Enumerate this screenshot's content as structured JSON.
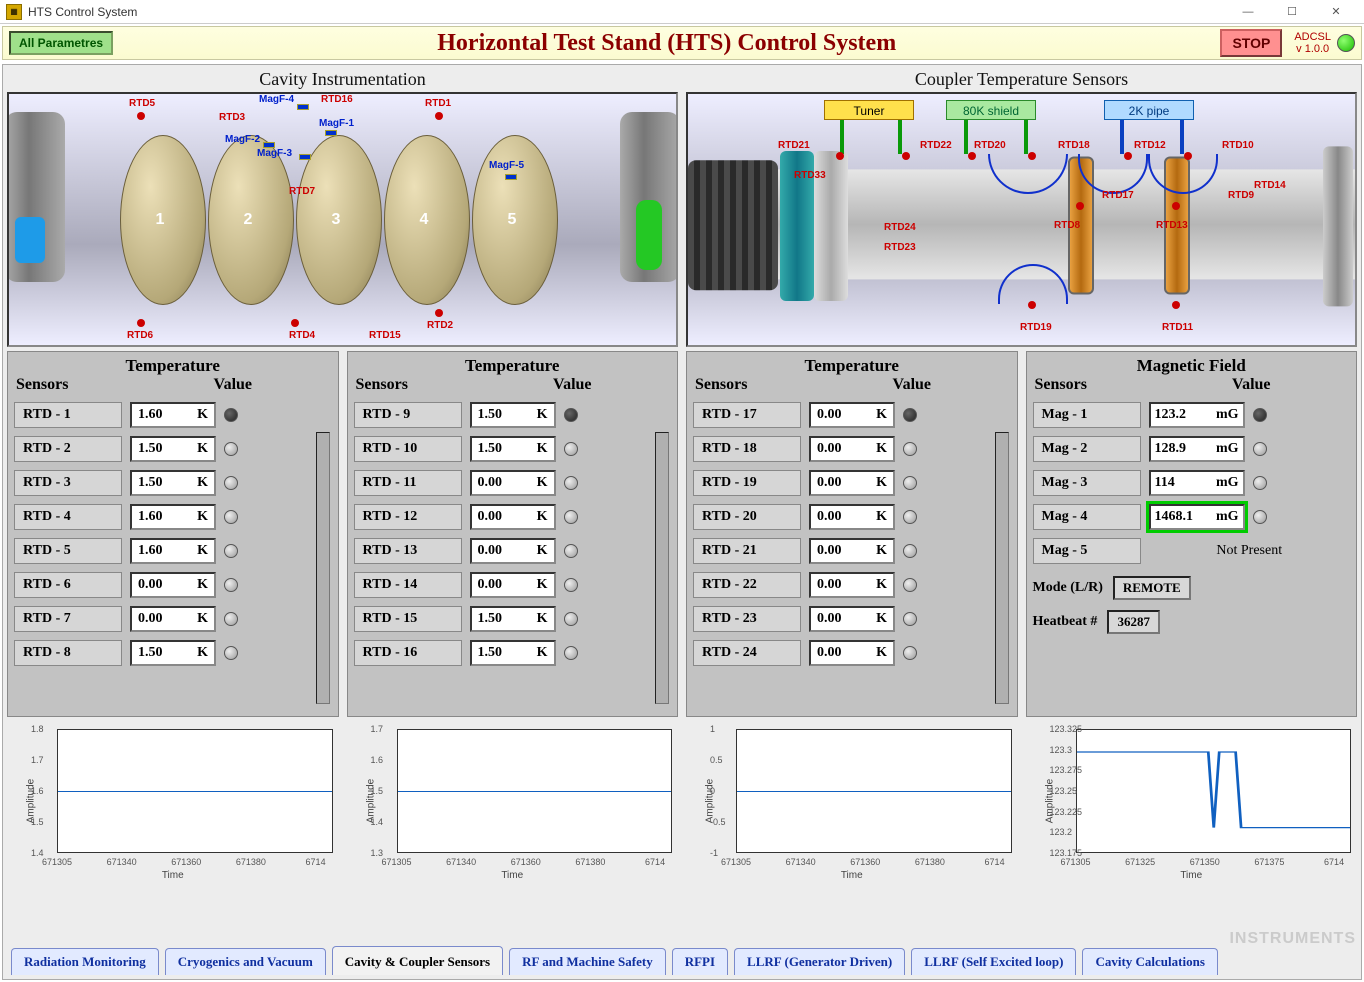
{
  "window": {
    "title": "HTS Control System"
  },
  "header": {
    "allparams": "All Parametres",
    "title": "Horizontal Test Stand (HTS) Control System",
    "stop": "STOP",
    "version_top": "ADCSL",
    "version_bottom": "v 1.0.0"
  },
  "diagrams": {
    "left_title": "Cavity Instrumentation",
    "right_title": "Coupler Temperature Sensors",
    "tuner": "Tuner",
    "shield": "80K  shield",
    "pipe": "2K pipe",
    "cavity_labels": [
      "RTD5",
      "RTD3",
      "MagF-4",
      "RTD16",
      "RTD1",
      "MagF-2",
      "MagF-1",
      "MagF-3",
      "RTD7",
      "MagF-5",
      "RTD6",
      "RTD4",
      "RTD15",
      "RTD2"
    ],
    "coupler_labels": [
      "RTD21",
      "RTD22",
      "RTD20",
      "RTD18",
      "RTD12",
      "RTD10",
      "RTD33",
      "RTD17",
      "RTD9",
      "RTD14",
      "RTD24",
      "RTD23",
      "RTD8",
      "RTD13",
      "RTD19",
      "RTD11"
    ]
  },
  "table_header": {
    "sensors": "Sensors",
    "value": "Value"
  },
  "panels": [
    {
      "title": "Temperature",
      "unit": "K",
      "rows": [
        {
          "name": "RTD - 1",
          "val": "1.60",
          "led": "dark"
        },
        {
          "name": "RTD - 2",
          "val": "1.50",
          "led": "off"
        },
        {
          "name": "RTD - 3",
          "val": "1.50",
          "led": "off"
        },
        {
          "name": "RTD - 4",
          "val": "1.60",
          "led": "off"
        },
        {
          "name": "RTD - 5",
          "val": "1.60",
          "led": "off"
        },
        {
          "name": "RTD - 6",
          "val": "0.00",
          "led": "off"
        },
        {
          "name": "RTD - 7",
          "val": "0.00",
          "led": "off"
        },
        {
          "name": "RTD - 8",
          "val": "1.50",
          "led": "off"
        }
      ]
    },
    {
      "title": "Temperature",
      "unit": "K",
      "rows": [
        {
          "name": "RTD - 9",
          "val": "1.50",
          "led": "dark"
        },
        {
          "name": "RTD - 10",
          "val": "1.50",
          "led": "off"
        },
        {
          "name": "RTD - 11",
          "val": "0.00",
          "led": "off"
        },
        {
          "name": "RTD - 12",
          "val": "0.00",
          "led": "off"
        },
        {
          "name": "RTD - 13",
          "val": "0.00",
          "led": "off"
        },
        {
          "name": "RTD - 14",
          "val": "0.00",
          "led": "off"
        },
        {
          "name": "RTD - 15",
          "val": "1.50",
          "led": "off"
        },
        {
          "name": "RTD - 16",
          "val": "1.50",
          "led": "off"
        }
      ]
    },
    {
      "title": "Temperature",
      "unit": "K",
      "rows": [
        {
          "name": "RTD - 17",
          "val": "0.00",
          "led": "dark"
        },
        {
          "name": "RTD - 18",
          "val": "0.00",
          "led": "off"
        },
        {
          "name": "RTD - 19",
          "val": "0.00",
          "led": "off"
        },
        {
          "name": "RTD - 20",
          "val": "0.00",
          "led": "off"
        },
        {
          "name": "RTD - 21",
          "val": "0.00",
          "led": "off"
        },
        {
          "name": "RTD - 22",
          "val": "0.00",
          "led": "off"
        },
        {
          "name": "RTD - 23",
          "val": "0.00",
          "led": "off"
        },
        {
          "name": "RTD - 24",
          "val": "0.00",
          "led": "off"
        }
      ]
    },
    {
      "title": "Magnetic Field",
      "unit": "mG",
      "rows": [
        {
          "name": "Mag - 1",
          "val": "123.2",
          "led": "dark"
        },
        {
          "name": "Mag - 2",
          "val": "128.9",
          "led": "off"
        },
        {
          "name": "Mag - 3",
          "val": "114",
          "led": "off"
        },
        {
          "name": "Mag - 4",
          "val": "1468.1",
          "led": "off",
          "hl": true
        },
        {
          "name": "Mag - 5",
          "val": "Not Present",
          "notpresent": true
        }
      ],
      "mode_label": "Mode (L/R)",
      "mode_val": "REMOTE",
      "hb_label": "Heatbeat #",
      "hb_val": "36287"
    }
  ],
  "chart_data": [
    {
      "type": "line",
      "ylabel": "Amplitude",
      "xlabel": "Time",
      "yticks": [
        "1.4",
        "1.5",
        "1.6",
        "1.7",
        "1.8"
      ],
      "xticks": [
        "671305",
        "671340",
        "671360",
        "671380",
        "6714"
      ],
      "trace_y": 0.5
    },
    {
      "type": "line",
      "ylabel": "Amplitude",
      "xlabel": "Time",
      "yticks": [
        "1.3",
        "1.4",
        "1.5",
        "1.6",
        "1.7"
      ],
      "xticks": [
        "671305",
        "671340",
        "671360",
        "671380",
        "6714"
      ],
      "trace_y": 0.5
    },
    {
      "type": "line",
      "ylabel": "Amplitude",
      "xlabel": "Time",
      "yticks": [
        "-1",
        "-0.5",
        "0",
        "0.5",
        "1"
      ],
      "xticks": [
        "671305",
        "671340",
        "671360",
        "671380",
        "6714"
      ],
      "trace_y": 0.5
    },
    {
      "type": "line",
      "ylabel": "Amplitude",
      "xlabel": "Time",
      "yticks": [
        "123.175",
        "123.2",
        "123.225",
        "123.25",
        "123.275",
        "123.3",
        "123.325"
      ],
      "xticks": [
        "671305",
        "671325",
        "671350",
        "671375",
        "6714"
      ],
      "trace_y": 0.2,
      "dip": true
    }
  ],
  "tabs": [
    "Radiation Monitoring",
    "Cryogenics and Vacuum",
    "Cavity & Coupler Sensors",
    "RF and Machine Safety",
    "RFPI",
    "LLRF (Generator Driven)",
    "LLRF (Self Excited loop)",
    "Cavity Calculations"
  ],
  "active_tab": 2,
  "watermark": "INSTRUMENTS"
}
